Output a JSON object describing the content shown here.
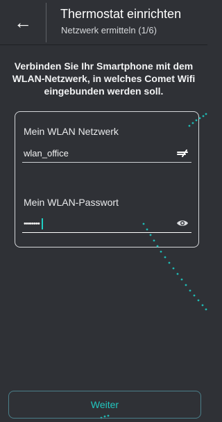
{
  "header": {
    "title": "Thermostat einrichten",
    "subtitle": "Netzwerk ermitteln (1/6)",
    "back_icon": "←"
  },
  "intro": {
    "text": "Verbinden Sie Ihr Smartphone mit dem WLAN-Netzwerk, in welches Comet Wifi eingebunden werden soll."
  },
  "form": {
    "network": {
      "label": "Mein WLAN Netzwerk",
      "value": "wlan_office",
      "icon": "wifi-select-icon"
    },
    "password": {
      "label": "Mein WLAN-Passwort",
      "value": "••••••••",
      "icon": "eye-icon"
    }
  },
  "footer": {
    "next_label": "Weiter"
  },
  "colors": {
    "background": "#2f3136",
    "accent": "#21c7c0",
    "hint_dots": "#1fb9b3"
  }
}
